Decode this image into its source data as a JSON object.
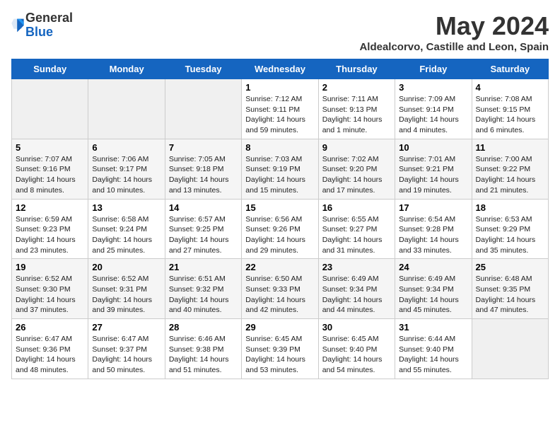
{
  "logo": {
    "general": "General",
    "blue": "Blue"
  },
  "header": {
    "month_title": "May 2024",
    "subtitle": "Aldealcorvo, Castille and Leon, Spain"
  },
  "weekdays": [
    "Sunday",
    "Monday",
    "Tuesday",
    "Wednesday",
    "Thursday",
    "Friday",
    "Saturday"
  ],
  "weeks": [
    [
      {
        "day": "",
        "info": ""
      },
      {
        "day": "",
        "info": ""
      },
      {
        "day": "",
        "info": ""
      },
      {
        "day": "1",
        "info": "Sunrise: 7:12 AM\nSunset: 9:11 PM\nDaylight: 14 hours\nand 59 minutes."
      },
      {
        "day": "2",
        "info": "Sunrise: 7:11 AM\nSunset: 9:13 PM\nDaylight: 14 hours\nand 1 minute."
      },
      {
        "day": "3",
        "info": "Sunrise: 7:09 AM\nSunset: 9:14 PM\nDaylight: 14 hours\nand 4 minutes."
      },
      {
        "day": "4",
        "info": "Sunrise: 7:08 AM\nSunset: 9:15 PM\nDaylight: 14 hours\nand 6 minutes."
      }
    ],
    [
      {
        "day": "5",
        "info": "Sunrise: 7:07 AM\nSunset: 9:16 PM\nDaylight: 14 hours\nand 8 minutes."
      },
      {
        "day": "6",
        "info": "Sunrise: 7:06 AM\nSunset: 9:17 PM\nDaylight: 14 hours\nand 10 minutes."
      },
      {
        "day": "7",
        "info": "Sunrise: 7:05 AM\nSunset: 9:18 PM\nDaylight: 14 hours\nand 13 minutes."
      },
      {
        "day": "8",
        "info": "Sunrise: 7:03 AM\nSunset: 9:19 PM\nDaylight: 14 hours\nand 15 minutes."
      },
      {
        "day": "9",
        "info": "Sunrise: 7:02 AM\nSunset: 9:20 PM\nDaylight: 14 hours\nand 17 minutes."
      },
      {
        "day": "10",
        "info": "Sunrise: 7:01 AM\nSunset: 9:21 PM\nDaylight: 14 hours\nand 19 minutes."
      },
      {
        "day": "11",
        "info": "Sunrise: 7:00 AM\nSunset: 9:22 PM\nDaylight: 14 hours\nand 21 minutes."
      }
    ],
    [
      {
        "day": "12",
        "info": "Sunrise: 6:59 AM\nSunset: 9:23 PM\nDaylight: 14 hours\nand 23 minutes."
      },
      {
        "day": "13",
        "info": "Sunrise: 6:58 AM\nSunset: 9:24 PM\nDaylight: 14 hours\nand 25 minutes."
      },
      {
        "day": "14",
        "info": "Sunrise: 6:57 AM\nSunset: 9:25 PM\nDaylight: 14 hours\nand 27 minutes."
      },
      {
        "day": "15",
        "info": "Sunrise: 6:56 AM\nSunset: 9:26 PM\nDaylight: 14 hours\nand 29 minutes."
      },
      {
        "day": "16",
        "info": "Sunrise: 6:55 AM\nSunset: 9:27 PM\nDaylight: 14 hours\nand 31 minutes."
      },
      {
        "day": "17",
        "info": "Sunrise: 6:54 AM\nSunset: 9:28 PM\nDaylight: 14 hours\nand 33 minutes."
      },
      {
        "day": "18",
        "info": "Sunrise: 6:53 AM\nSunset: 9:29 PM\nDaylight: 14 hours\nand 35 minutes."
      }
    ],
    [
      {
        "day": "19",
        "info": "Sunrise: 6:52 AM\nSunset: 9:30 PM\nDaylight: 14 hours\nand 37 minutes."
      },
      {
        "day": "20",
        "info": "Sunrise: 6:52 AM\nSunset: 9:31 PM\nDaylight: 14 hours\nand 39 minutes."
      },
      {
        "day": "21",
        "info": "Sunrise: 6:51 AM\nSunset: 9:32 PM\nDaylight: 14 hours\nand 40 minutes."
      },
      {
        "day": "22",
        "info": "Sunrise: 6:50 AM\nSunset: 9:33 PM\nDaylight: 14 hours\nand 42 minutes."
      },
      {
        "day": "23",
        "info": "Sunrise: 6:49 AM\nSunset: 9:34 PM\nDaylight: 14 hours\nand 44 minutes."
      },
      {
        "day": "24",
        "info": "Sunrise: 6:49 AM\nSunset: 9:34 PM\nDaylight: 14 hours\nand 45 minutes."
      },
      {
        "day": "25",
        "info": "Sunrise: 6:48 AM\nSunset: 9:35 PM\nDaylight: 14 hours\nand 47 minutes."
      }
    ],
    [
      {
        "day": "26",
        "info": "Sunrise: 6:47 AM\nSunset: 9:36 PM\nDaylight: 14 hours\nand 48 minutes."
      },
      {
        "day": "27",
        "info": "Sunrise: 6:47 AM\nSunset: 9:37 PM\nDaylight: 14 hours\nand 50 minutes."
      },
      {
        "day": "28",
        "info": "Sunrise: 6:46 AM\nSunset: 9:38 PM\nDaylight: 14 hours\nand 51 minutes."
      },
      {
        "day": "29",
        "info": "Sunrise: 6:45 AM\nSunset: 9:39 PM\nDaylight: 14 hours\nand 53 minutes."
      },
      {
        "day": "30",
        "info": "Sunrise: 6:45 AM\nSunset: 9:40 PM\nDaylight: 14 hours\nand 54 minutes."
      },
      {
        "day": "31",
        "info": "Sunrise: 6:44 AM\nSunset: 9:40 PM\nDaylight: 14 hours\nand 55 minutes."
      },
      {
        "day": "",
        "info": ""
      }
    ]
  ]
}
